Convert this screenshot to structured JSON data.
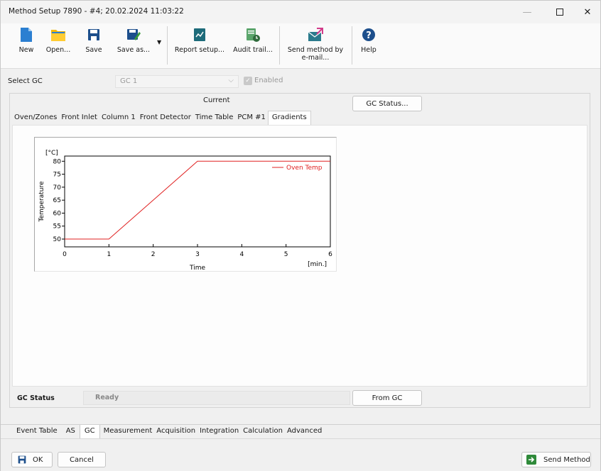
{
  "window": {
    "title": "Method Setup 7890 - #4;  20.02.2024  11:03:22"
  },
  "toolbar": {
    "new": "New",
    "open": "Open...",
    "save": "Save",
    "save_as": "Save as...",
    "report_setup": "Report setup...",
    "audit_trail": "Audit trail...",
    "send_method_email_line1": "Send method by",
    "send_method_email_line2": "e-mail...",
    "help": "Help"
  },
  "select_gc": {
    "label": "Select GC",
    "value": "GC 1",
    "enabled_label": "Enabled",
    "enabled_checked": true
  },
  "panel": {
    "current_label": "Current",
    "gc_status_button": "GC Status...",
    "tabs": [
      "Oven/Zones",
      "Front Inlet",
      "Column 1",
      "Front Detector",
      "Time Table",
      "PCM #1",
      "Gradients"
    ],
    "active_tab": "Gradients"
  },
  "chart_data": {
    "type": "line",
    "y_unit_label": "[°C]",
    "ylabel": "Temperature",
    "xlabel": "Time",
    "x_unit_label": "[min.]",
    "xlim": [
      0,
      6
    ],
    "ylim": [
      47,
      82
    ],
    "x_ticks": [
      "0",
      "1",
      "2",
      "3",
      "4",
      "5",
      "6"
    ],
    "y_ticks": [
      "80",
      "75",
      "70",
      "65",
      "60",
      "55",
      "50"
    ],
    "grid": false,
    "legend_position": "top-right",
    "series": [
      {
        "name": "Oven Temp",
        "color": "#e02020",
        "x": [
          0,
          1,
          3,
          6
        ],
        "y": [
          50,
          50,
          80,
          80
        ]
      }
    ]
  },
  "gc_status": {
    "label": "GC Status",
    "value": "Ready",
    "from_gc_button": "From GC"
  },
  "bottom_tabs": [
    "Event Table",
    "AS",
    "GC",
    "Measurement",
    "Acquisition",
    "Integration",
    "Calculation",
    "Advanced"
  ],
  "active_bottom_tab": "GC",
  "footer": {
    "ok": "OK",
    "cancel": "Cancel",
    "send_method": "Send Method"
  },
  "colors": {
    "accent": "#0a5fb4",
    "plot_line": "#e02020",
    "folder": "#f5b800",
    "green": "#3a9b3a"
  }
}
